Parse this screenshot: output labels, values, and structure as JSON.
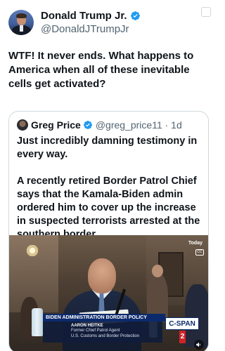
{
  "post": {
    "author": {
      "display_name": "Donald Trump Jr.",
      "handle": "@DonaldJTrumpJr",
      "verified": true,
      "avatar_icon": "profile-photo"
    },
    "text": "WTF! It never ends. What happens to America when all of these inevitable cells get activated?"
  },
  "quote": {
    "author": {
      "display_name": "Greg Price",
      "handle": "@greg_price11 · 1d",
      "verified": true
    },
    "text": "Just incredibly damning testimony in every way.\n\nA recently retired Border Patrol Chief says that the Kamala-Biden admin ordered him to cover up the increase in suspected terrorists arrested at the southern border.",
    "video": {
      "overlay_badge": "Today",
      "captions_icon": "cc",
      "chyron_title": "BIDEN ADMINISTRATION BORDER POLICY",
      "chyron_name": "AARON HEITKE",
      "chyron_role_1": "Former Chief Patrol Agent",
      "chyron_role_2": "U.S. Customs and Border Protection",
      "network": "C-SPAN",
      "network_num": "2",
      "volume_icon": "speaker-icon"
    }
  },
  "colors": {
    "verified_blue": "#1d9bf0",
    "text": "#0f1419",
    "muted": "#536471",
    "border": "#cfd9de",
    "chyron_blue": "#0c2a6b",
    "cspan_red": "#d1232a"
  }
}
